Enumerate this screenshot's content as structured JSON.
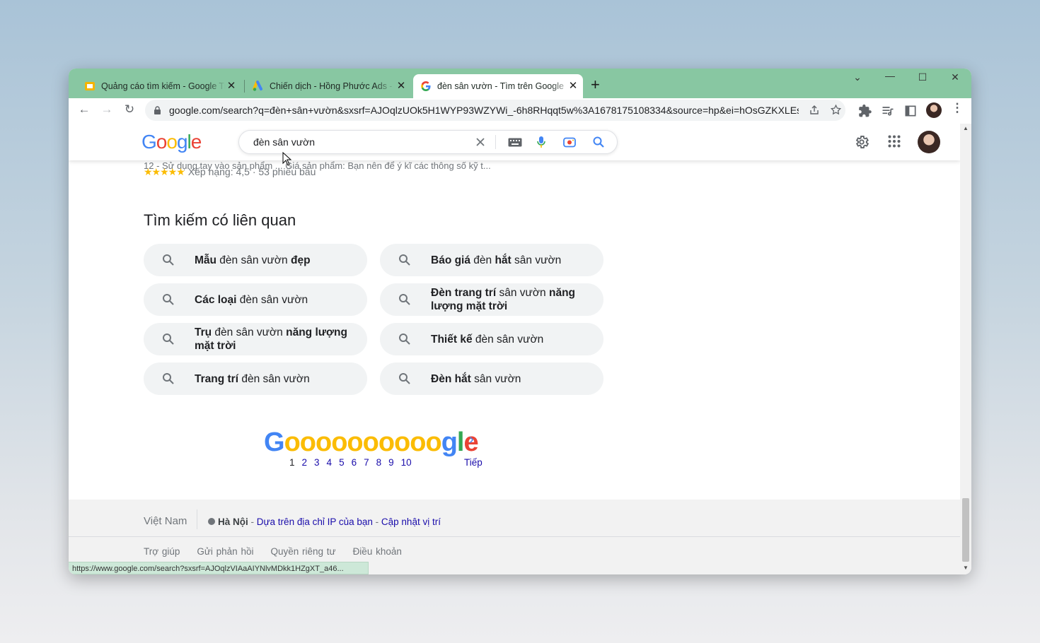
{
  "tabs": [
    {
      "title": "Quảng cáo tìm kiếm - Google Tr"
    },
    {
      "title": "Chiến dịch - Hồng Phước Ads - C"
    },
    {
      "title": "đèn sân vườn - Tìm trên Google"
    }
  ],
  "toolbar": {
    "url": "google.com/search?q=đèn+sân+vườn&sxsrf=AJOqlzUOk5H1WYP93WZYWi_-6h8RHqqt5w%3A1678175108334&source=hp&ei=hOsGZKXLEsv..."
  },
  "google": {
    "logo": "Google",
    "query": "đèn sân vườn"
  },
  "result_snippet": {
    "cut_text": "12 - Sử dụng tay vào sản phẩm ... Giá sản phẩm: Bạn nên để ý kĩ các thông số kỹ t...",
    "stars": "★★★★★",
    "rating": "Xếp hạng: 4,5 · 53 phiếu bầu"
  },
  "related": {
    "title": "Tìm kiếm có liên quan",
    "items": [
      {
        "b1": "Mẫu",
        "n1": " đèn sân vườn ",
        "b2": "đẹp",
        "n2": ""
      },
      {
        "b1": "Báo giá",
        "n1": " đèn ",
        "b2": "hắt",
        "n2": " sân vườn"
      },
      {
        "b1": "Các loại",
        "n1": " đèn sân vườn",
        "b2": "",
        "n2": ""
      },
      {
        "b1": "Đèn trang trí",
        "n1": " sân vườn ",
        "b2": "năng lượng mặt trời",
        "n2": ""
      },
      {
        "b1": "Trụ",
        "n1": " đèn sân vườn ",
        "b2": "năng lượng mặt trời",
        "n2": ""
      },
      {
        "b1": "Thiết kế",
        "n1": " đèn sân vườn",
        "b2": "",
        "n2": ""
      },
      {
        "b1": "Trang trí",
        "n1": " đèn sân vườn",
        "b2": "",
        "n2": ""
      },
      {
        "b1": "Đèn hắt",
        "n1": " sân vườn",
        "b2": "",
        "n2": ""
      }
    ]
  },
  "pagination": {
    "logo_G": "G",
    "logo_o": "oooooooooo",
    "logo_gle": "gle",
    "pages": [
      "1",
      "2",
      "3",
      "4",
      "5",
      "6",
      "7",
      "8",
      "9",
      "10"
    ],
    "current": "1",
    "next": "Tiếp"
  },
  "footer": {
    "country": "Việt Nam",
    "city": "Hà Nội",
    "ip_text": "Dựa trên địa chỉ IP của bạn",
    "update": "Cập nhật vị trí",
    "links": [
      "Trợ giúp",
      "Gửi phản hồi",
      "Quyền riêng tư",
      "Điều khoản"
    ]
  },
  "status_url": "https://www.google.com/search?sxsrf=AJOqlzVIAaAIYNlvMDkk1HZgXT_a46...",
  "colors": {
    "tabstrip": "#88c7a2",
    "google_blue": "#4285f4",
    "google_red": "#ea4335",
    "google_yellow": "#fbbc04",
    "google_green": "#34a853",
    "link": "#1a0dab"
  }
}
